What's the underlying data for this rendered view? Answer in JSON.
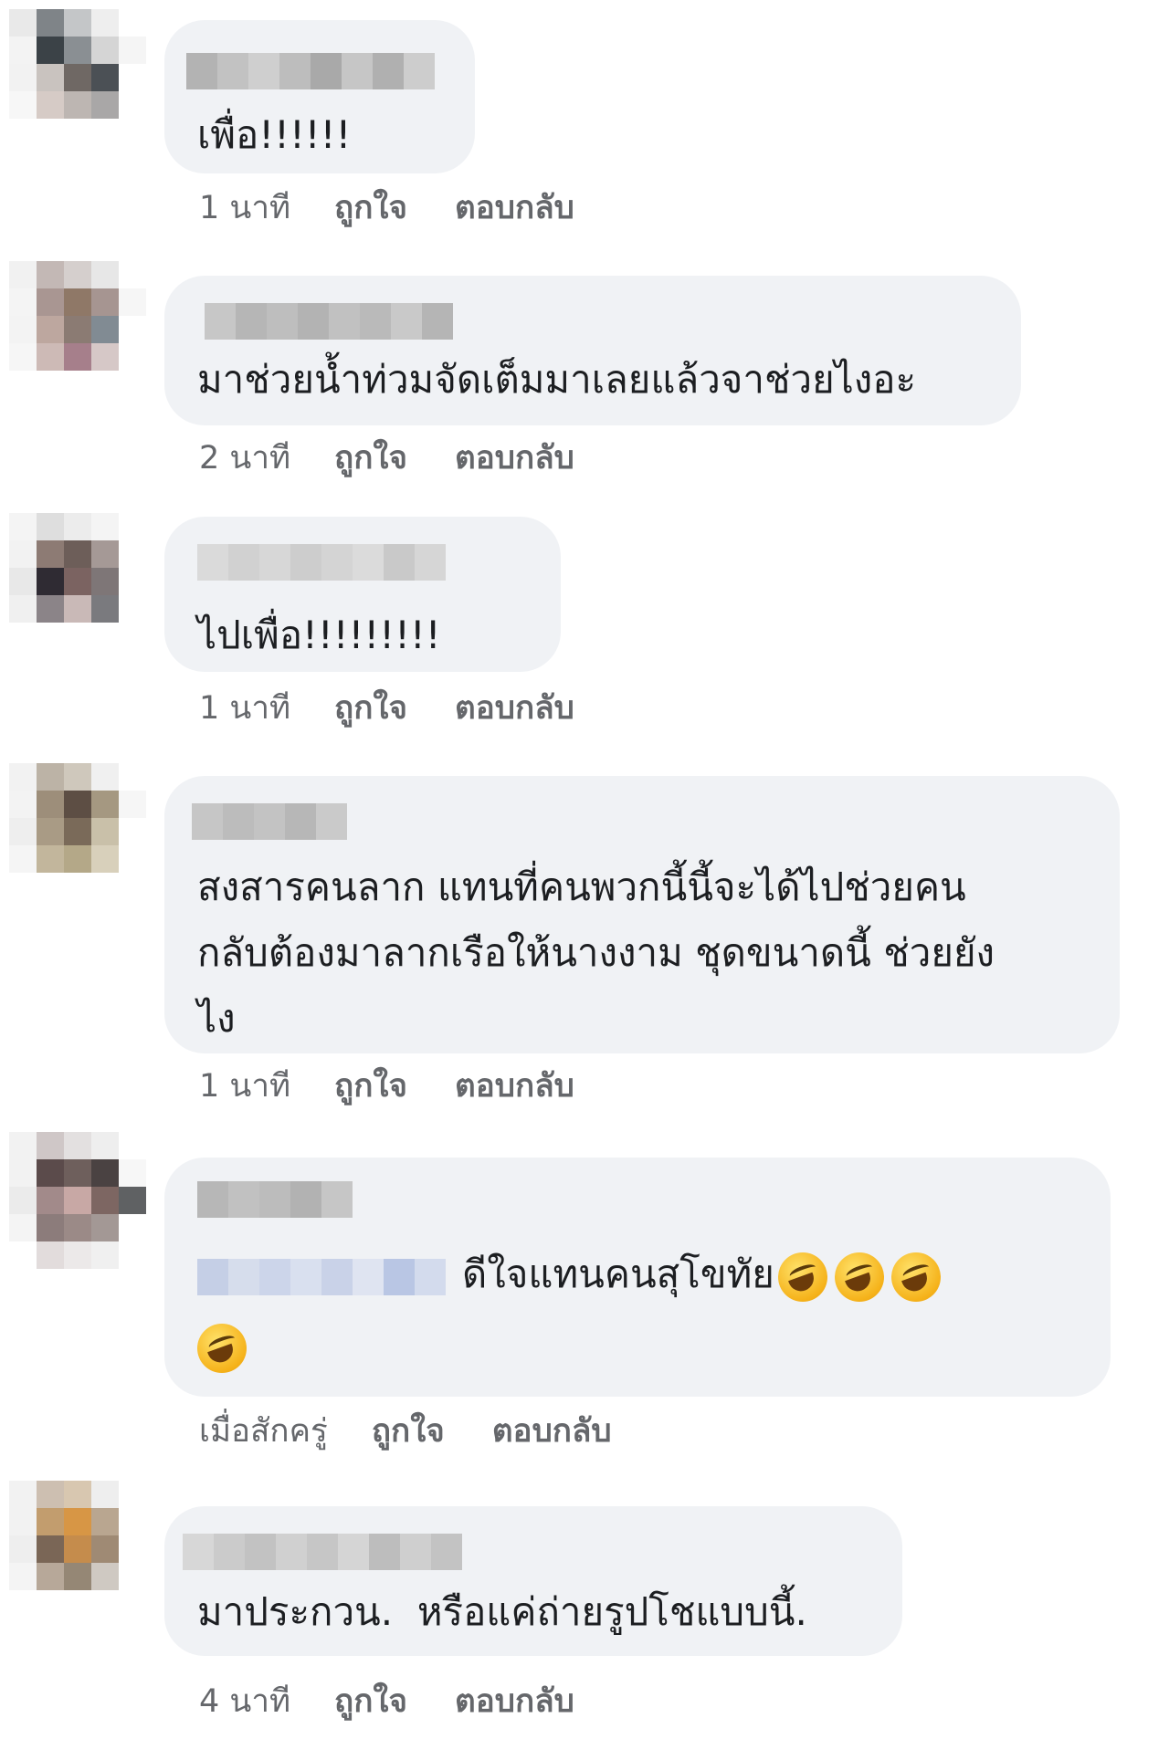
{
  "comments": [
    {
      "text": "เพื่อ!!!!!!",
      "time": "1 นาที",
      "like_label": "ถูกใจ",
      "reply_label": "ตอบกลับ"
    },
    {
      "text": "มาช่วยน้ำท่วมจัดเต็มมาเลยแล้วจาช่วยไงอะ",
      "time": "2 นาที",
      "like_label": "ถูกใจ",
      "reply_label": "ตอบกลับ"
    },
    {
      "text": "ไปเพื่อ!!!!!!!!!",
      "time": "1 นาที",
      "like_label": "ถูกใจ",
      "reply_label": "ตอบกลับ"
    },
    {
      "text_lines": [
        "สงสารคนลาก แทนที่คนพวกนี้นี้จะได้ไปช่วยคน",
        "กลับต้องมาลากเรือให้นางงาม ชุดขนาดนี้ ช่วยยัง",
        "ไง"
      ],
      "time": "1 นาที",
      "like_label": "ถูกใจ",
      "reply_label": "ตอบกลับ"
    },
    {
      "text": "ดีใจแทนคนสุโขทัย",
      "emojis": [
        "rolling-on-floor-laughing",
        "rolling-on-floor-laughing",
        "rolling-on-floor-laughing",
        "rolling-on-floor-laughing"
      ],
      "time": "เมื่อสักครู่",
      "like_label": "ถูกใจ",
      "reply_label": "ตอบกลับ"
    },
    {
      "text": "มาประกวน.  หรือแค่ถ่ายรูปโชแบบนี้.",
      "time": "4 นาที",
      "like_label": "ถูกใจ",
      "reply_label": "ตอบกลับ"
    }
  ],
  "colors": {
    "bubble_bg": "#f0f2f5",
    "text": "#1c1e21",
    "meta": "#65676b"
  }
}
